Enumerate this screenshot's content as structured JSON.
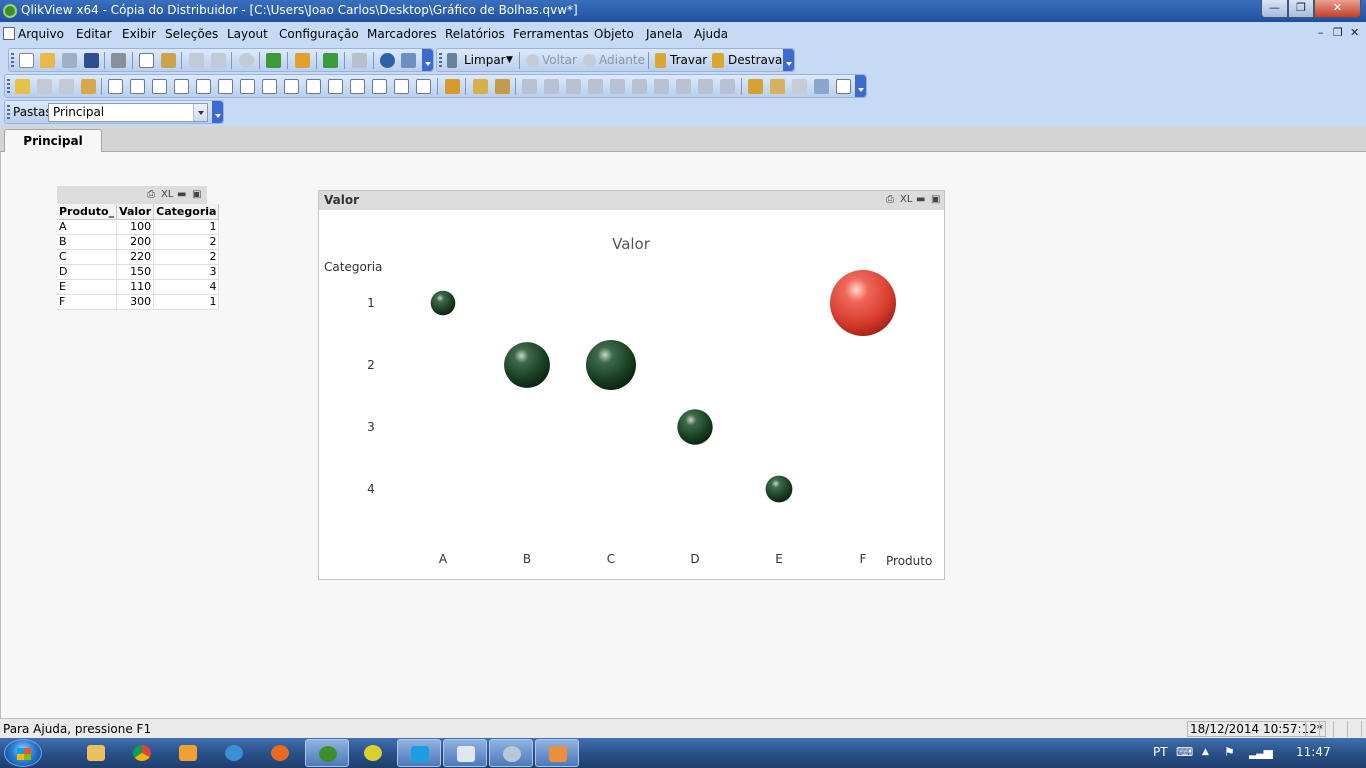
{
  "window": {
    "title": "QlikView x64 - Cópia do Distribuidor - [C:\\Users\\Joao Carlos\\Desktop\\Gráfico de Bolhas.qvw*]"
  },
  "menu": [
    "Arquivo",
    "Editar",
    "Exibir",
    "Seleções",
    "Layout",
    "Configuração",
    "Marcadores",
    "Relatórios",
    "Ferramentas",
    "Objeto",
    "Janela",
    "Ajuda"
  ],
  "toolbar": {
    "limpar": "Limpar",
    "voltar": "Voltar",
    "adiante": "Adiante",
    "travar": "Travar",
    "destravar": "Destravar"
  },
  "pastas": {
    "label": "Pastas",
    "selected": "Principal"
  },
  "tabs": [
    {
      "label": "Principal"
    }
  ],
  "table": {
    "caption_icons": [
      "print-icon",
      "xl-icon",
      "minimize-icon",
      "maximize-icon"
    ],
    "xl": "XL",
    "headers": [
      "Produto_",
      "Valor",
      "Categoria"
    ],
    "rows": [
      [
        "A",
        "100",
        "1"
      ],
      [
        "B",
        "200",
        "2"
      ],
      [
        "C",
        "220",
        "2"
      ],
      [
        "D",
        "150",
        "3"
      ],
      [
        "E",
        "110",
        "4"
      ],
      [
        "F",
        "300",
        "1"
      ]
    ]
  },
  "chart_box": {
    "caption": "Valor",
    "xl": "XL"
  },
  "chart_data": {
    "type": "scatter",
    "title": "Valor",
    "xlabel": "Produto",
    "ylabel": "Categoria",
    "x_categories": [
      "A",
      "B",
      "C",
      "D",
      "E",
      "F"
    ],
    "y_categories": [
      "1",
      "2",
      "3",
      "4"
    ],
    "y_reversed": true,
    "points": [
      {
        "x": "A",
        "y": 1,
        "size": 100,
        "color": "#1e4a2a"
      },
      {
        "x": "B",
        "y": 2,
        "size": 200,
        "color": "#1e4a2a"
      },
      {
        "x": "C",
        "y": 2,
        "size": 220,
        "color": "#1e4a2a"
      },
      {
        "x": "D",
        "y": 3,
        "size": 150,
        "color": "#1e4a2a"
      },
      {
        "x": "E",
        "y": 4,
        "size": 110,
        "color": "#1e4a2a"
      },
      {
        "x": "F",
        "y": 1,
        "size": 300,
        "color": "#e0463a"
      }
    ],
    "grid": false,
    "legend": "none"
  },
  "status": {
    "help": "Para Ajuda, pressione F1",
    "datetime": "18/12/2014 10:57:12*"
  },
  "taskbar": {
    "lang": "PT",
    "clock": "11:47"
  }
}
